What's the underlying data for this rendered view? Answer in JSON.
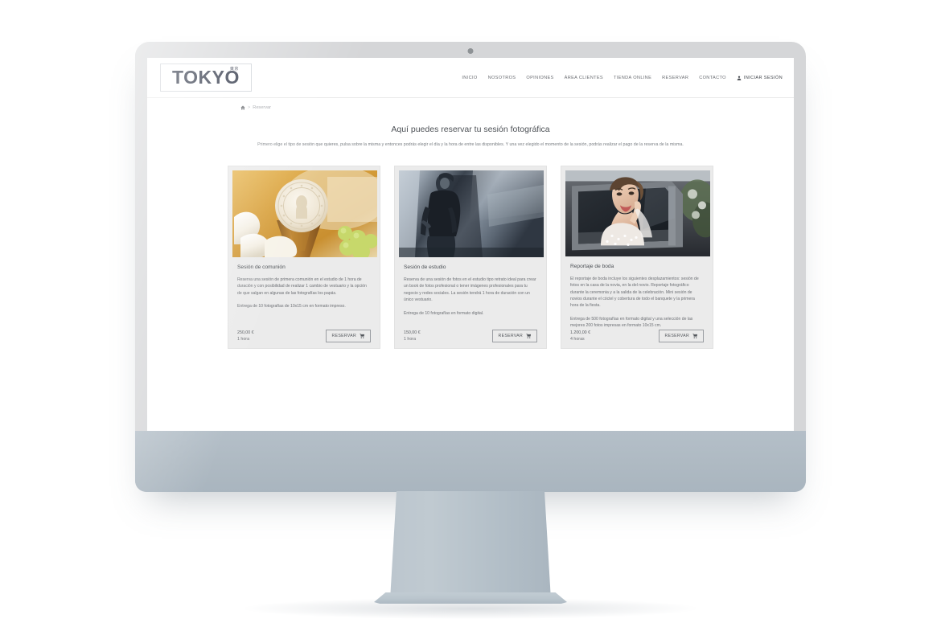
{
  "device": {
    "type": "desktop-monitor",
    "bezel_color": "#d5d6d8",
    "chin_color": "#aeb9c2"
  },
  "site": {
    "logo": {
      "text": "TOKYO",
      "kanji": "東京"
    },
    "nav": {
      "items": [
        {
          "label": "INICIO"
        },
        {
          "label": "NOSOTROS"
        },
        {
          "label": "OPINIONES"
        },
        {
          "label": "ÁREA CLIENTES"
        },
        {
          "label": "TIENDA ONLINE"
        },
        {
          "label": "RESERVAR"
        },
        {
          "label": "CONTACTO"
        }
      ],
      "login": {
        "label": "INICIAR SESIÓN",
        "icon": "user-icon"
      }
    },
    "breadcrumb": {
      "home_icon": "home-icon",
      "separator": ">",
      "current": "Reservar"
    },
    "heading": "Aquí puedes reservar tu sesión fotográfica",
    "subheading": "Primero elige el tipo de sesión que quieres, pulsa sobre la misma y entonces podrás elegir el día y la hora de entre las disponibles. Y una vez elegido el momento de la sesión, podrás realizar el pago de la reserva de la misma.",
    "cards": [
      {
        "image_alt": "communion-host-chalice-photo",
        "title": "Sesión de comunión",
        "description": "Reserva una sesión de primera comunión en el estudio de 1 hora de duración y con posibilidad de realizar 1 cambio de vestuario y la opción de que salgan en algunas de las fotografías los papás.",
        "delivery": "Entrega de 10 fotografías de 10x15 cm en formato impreso.",
        "price": "250,00 €",
        "duration": "1 hora",
        "button": {
          "label": "RESERVAR",
          "icon": "cart-icon"
        }
      },
      {
        "image_alt": "studio-portrait-man-photo",
        "title": "Sesión de estudio",
        "description": "Reserva de una sesión de fotos en el estudio tipo retrato ideal para crear un book de fotos profesional o tener imágenes profesionales para tu negocio y redes sociales. La sesión tendrá 1 hora de duración con un único vestuario.",
        "delivery": "Entrega de 10 fotografías en formato digital.",
        "price": "150,00 €",
        "duration": "1 hora",
        "button": {
          "label": "RESERVAR",
          "icon": "cart-icon"
        }
      },
      {
        "image_alt": "bride-in-car-window-photo",
        "title": "Reportaje de boda",
        "description": "El reportaje de boda incluye los siguientes desplazamientos: sesión de fotos en la casa de la novia, en la del novio. Reportaje fotográfico durante la ceremonia y a la salida de la celebración. Mini sesión de novios durante el cóctel y cobertura de todo el banquete y la primera hora de la fiesta.",
        "delivery": "Entrega de 500 fotografías en formato digital y una selección de las mejores 200 fotos impresas en formato 10x15 cm.",
        "price": "1.200,00 €",
        "duration": "4 horas",
        "button": {
          "label": "RESERVAR",
          "icon": "cart-icon"
        }
      }
    ]
  }
}
